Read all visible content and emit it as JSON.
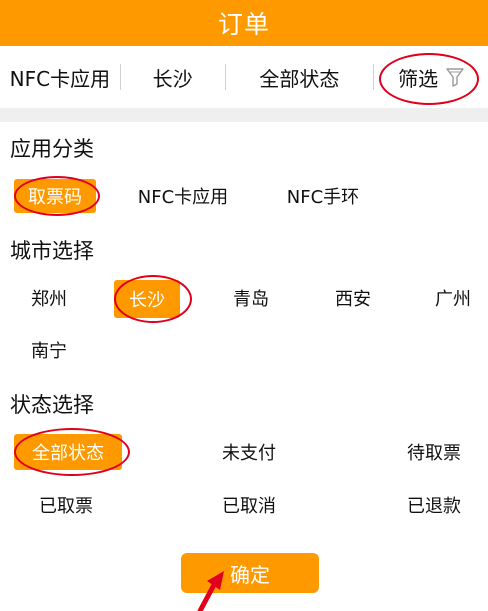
{
  "header": {
    "title": "订单"
  },
  "filter_bar": {
    "app": "NFC卡应用",
    "city": "长沙",
    "status": "全部状态",
    "filter": "筛选",
    "filter_icon": "funnel-icon"
  },
  "categories": {
    "title": "应用分类",
    "options": [
      "取票码",
      "NFC卡应用",
      "NFC手环"
    ],
    "selected": "取票码"
  },
  "cities": {
    "title": "城市选择",
    "options": [
      "郑州",
      "长沙",
      "青岛",
      "西安",
      "广州",
      "南宁"
    ],
    "selected": "长沙"
  },
  "statuses": {
    "title": "状态选择",
    "options": [
      "全部状态",
      "未支付",
      "待取票",
      "已取票",
      "已取消",
      "已退款"
    ],
    "selected": "全部状态"
  },
  "confirm_label": "确定",
  "colors": {
    "accent": "#FF9900",
    "annotation": "#E0001B",
    "divider": "#EFEFEF"
  }
}
